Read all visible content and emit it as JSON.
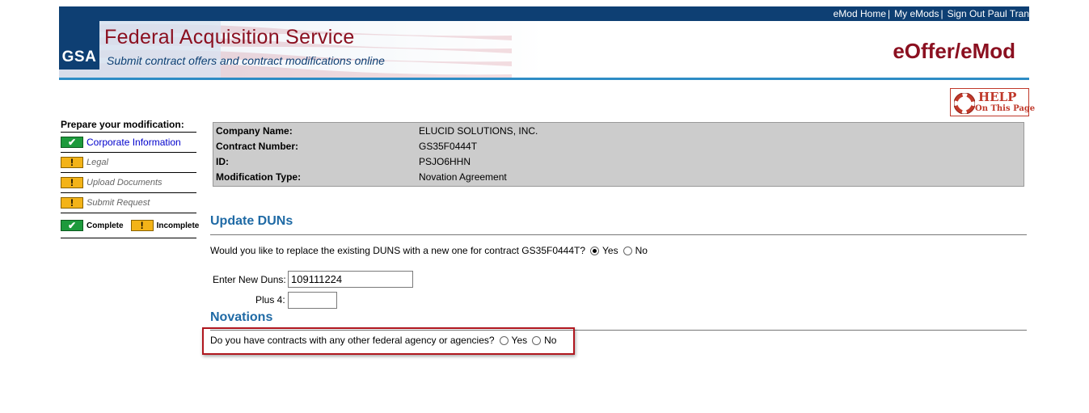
{
  "header": {
    "top_links": {
      "emod_home": "eMod Home",
      "my_emods": "My eMods",
      "sign_out": "Sign Out Paul Tran",
      "separator": "|"
    },
    "logo": "GSA",
    "agency_title": "Federal Acquisition Service",
    "agency_subtitle": "Submit contract offers and contract modifications online",
    "app_title": "eOffer/eMod",
    "help": {
      "line1": "HELP",
      "line2": "On This Page"
    }
  },
  "sidebar": {
    "title": "Prepare your modification:",
    "items": [
      {
        "label": "Corporate Information",
        "status": "complete",
        "status_icon": "check-icon",
        "link": true
      },
      {
        "label": "Legal",
        "status": "incomplete",
        "status_icon": "exclamation-icon",
        "link": false
      },
      {
        "label": "Upload Documents",
        "status": "incomplete",
        "status_icon": "exclamation-icon",
        "link": false
      },
      {
        "label": "Submit Request",
        "status": "incomplete",
        "status_icon": "exclamation-icon",
        "link": false
      }
    ],
    "legend": {
      "complete": "Complete",
      "incomplete": "Incomplete"
    }
  },
  "info": {
    "company_label": "Company Name:",
    "company_value": "ELUCID SOLUTIONS, INC.",
    "contract_label": "Contract Number:",
    "contract_value": "GS35F0444T",
    "id_label": "ID:",
    "id_value": "PSJO6HHN",
    "modtype_label": "Modification Type:",
    "modtype_value": "Novation Agreement"
  },
  "duns": {
    "heading": "Update DUNs",
    "question": "Would you like to replace the existing DUNS with a new one for contract GS35F0444T?",
    "yes_label": "Yes",
    "no_label": "No",
    "selected": "Yes",
    "new_duns_label": "Enter New Duns:",
    "new_duns_value": "109111224",
    "plus4_label": "Plus 4:",
    "plus4_value": ""
  },
  "novations": {
    "heading": "Novations",
    "question": "Do you have contracts with any other federal agency or agencies?",
    "yes_label": "Yes",
    "no_label": "No",
    "selected": null
  },
  "colors": {
    "brand_navy": "#0e3f73",
    "brand_red": "#8b1020",
    "heading_blue": "#1f6aa5",
    "complete_green": "#1d9a3c",
    "incomplete_yellow": "#f3b318",
    "highlight_red": "#b0161e"
  }
}
